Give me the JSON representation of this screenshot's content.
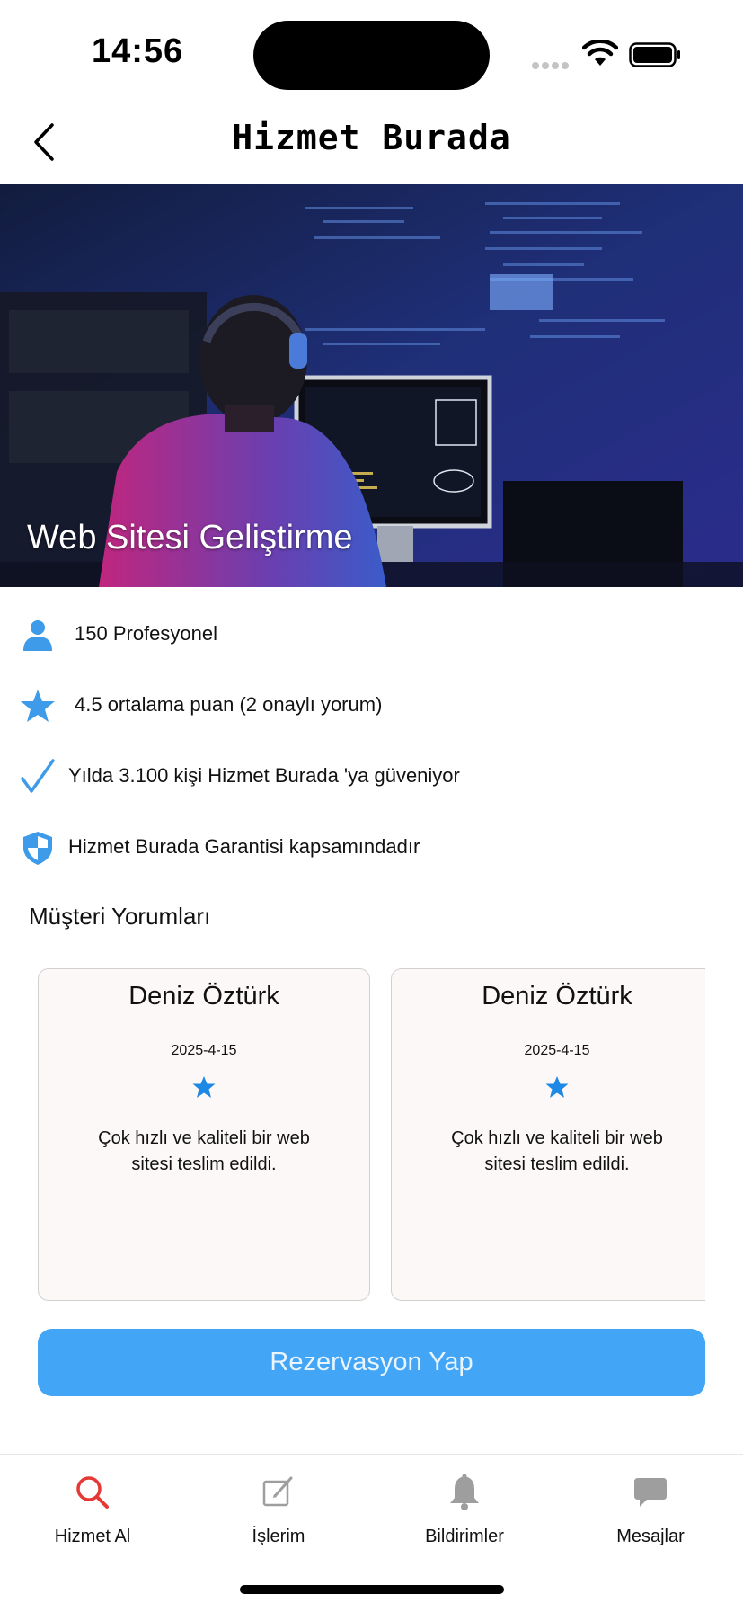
{
  "status_bar": {
    "time": "14:56"
  },
  "header": {
    "title": "Hizmet Burada",
    "back_icon": "chevron-left-icon"
  },
  "hero": {
    "title": "Web Sitesi Geliştirme"
  },
  "info": [
    {
      "icon": "person-icon",
      "text": "150 Profesyonel"
    },
    {
      "icon": "star-icon",
      "text": "4.5 ortalama puan (2 onaylı yorum)"
    },
    {
      "icon": "checkmark-icon",
      "text": "Yılda 3.100 kişi Hizmet Burada 'ya güveniyor"
    },
    {
      "icon": "shield-icon",
      "text": "Hizmet Burada Garantisi kapsamındadır"
    }
  ],
  "reviews": {
    "title": "Müşteri Yorumları",
    "items": [
      {
        "name": "Deniz Öztürk",
        "date": "2025-4-15",
        "stars": 1,
        "text": "Çok hızlı ve kaliteli bir web sitesi teslim edildi."
      },
      {
        "name": "Deniz Öztürk",
        "date": "2025-4-15",
        "stars": 1,
        "text": "Çok hızlı ve kaliteli bir web sitesi teslim edildi."
      }
    ]
  },
  "cta": {
    "label": "Rezervasyon Yap"
  },
  "tabs": [
    {
      "label": "Hizmet Al",
      "icon": "search-icon",
      "active": true
    },
    {
      "label": "İşlerim",
      "icon": "edit-icon",
      "active": false
    },
    {
      "label": "Bildirimler",
      "icon": "bell-icon",
      "active": false
    },
    {
      "label": "Mesajlar",
      "icon": "chat-bubble-icon",
      "active": false
    }
  ],
  "colors": {
    "accent": "#42a5f5",
    "icon_blue": "#3d9be9",
    "star_blue": "#1e88e5",
    "active_tab": "#e53935",
    "inactive_tab": "#9e9e9e"
  }
}
